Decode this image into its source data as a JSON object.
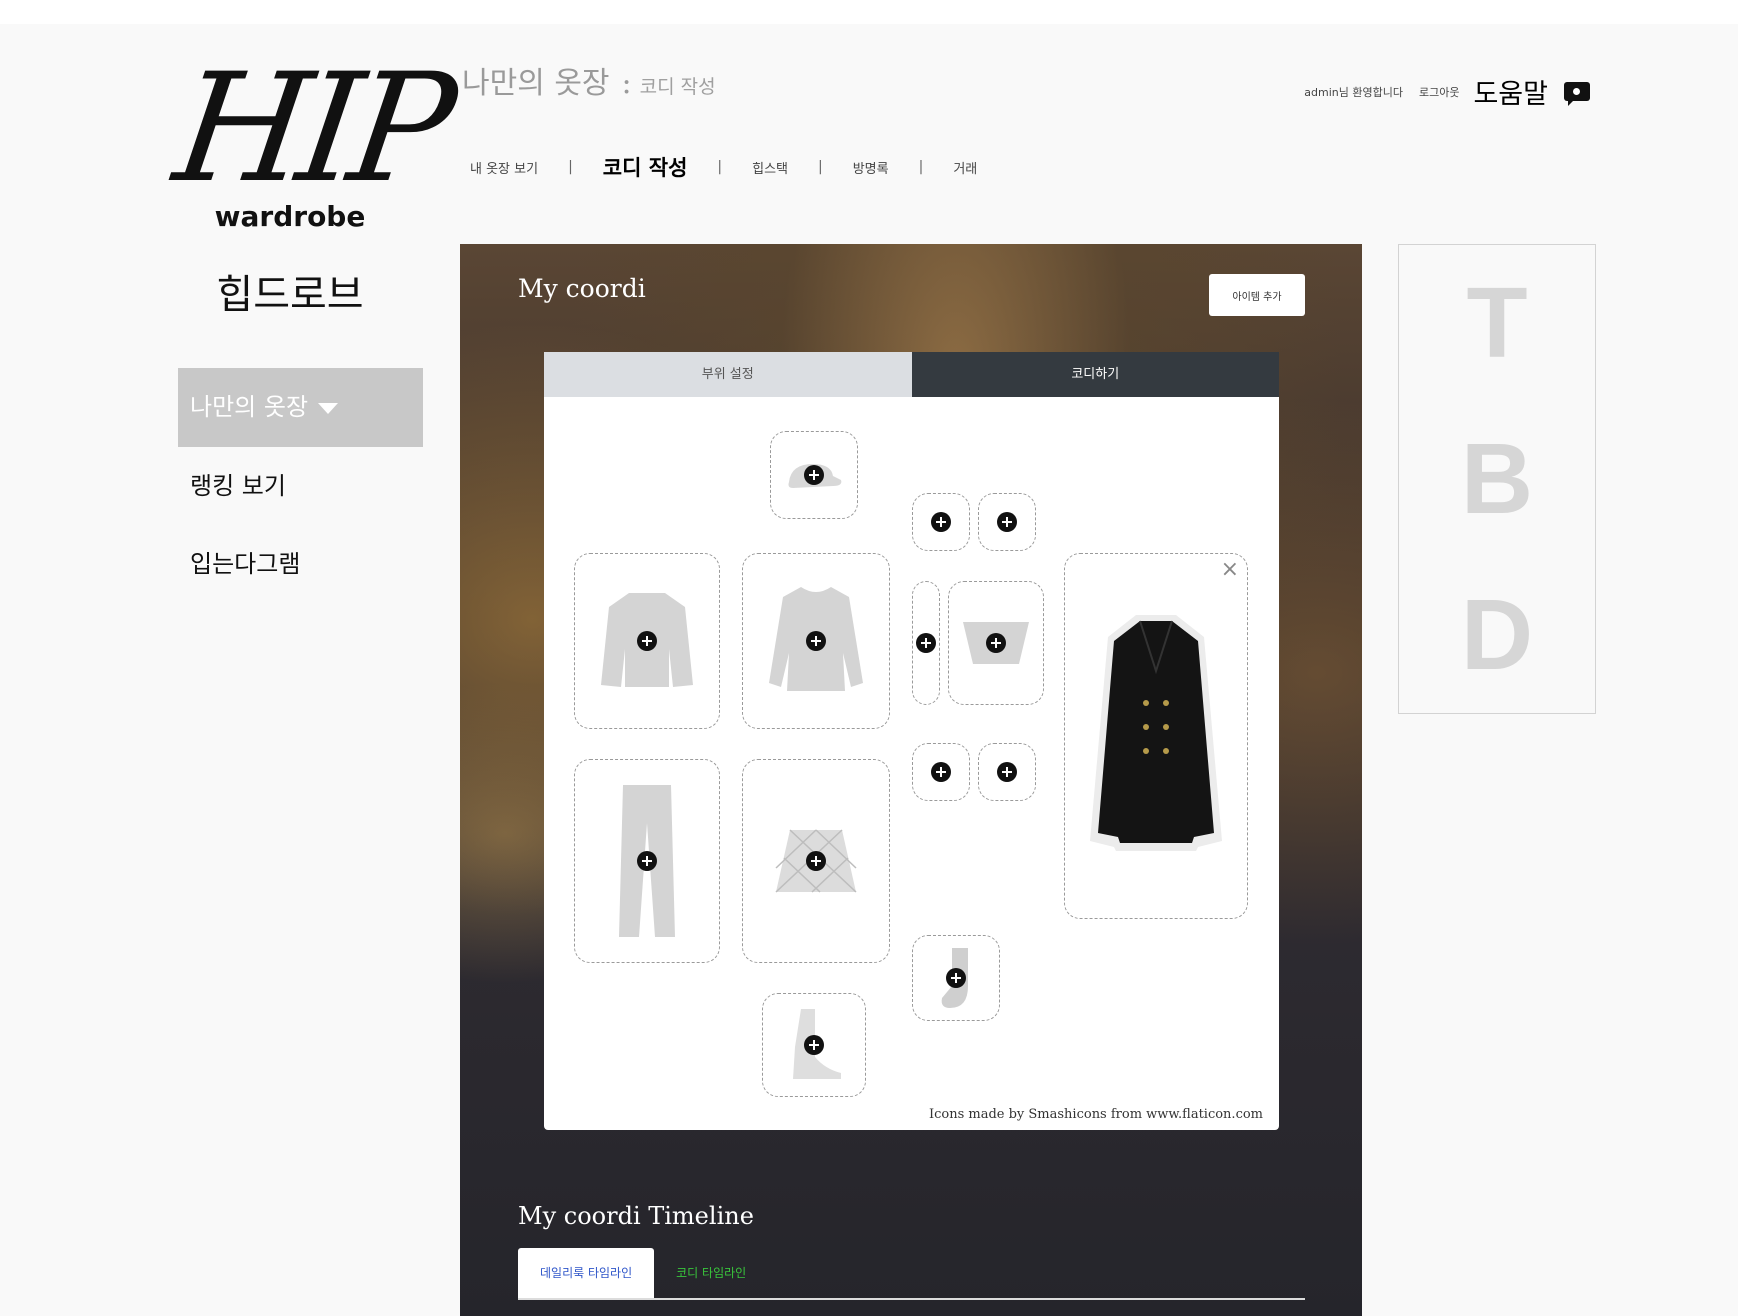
{
  "logo": {
    "mark": "HIP",
    "subtitle": "wardrobe",
    "korean": "힙드로브"
  },
  "sidebar": {
    "items": [
      {
        "label": "나만의 옷장"
      },
      {
        "label": "랭킹 보기"
      },
      {
        "label": "입는다그램"
      }
    ]
  },
  "header": {
    "title": "나만의 옷장",
    "separator": ":",
    "subtitle": "코디 작성",
    "nav": [
      {
        "label": "내 옷장 보기"
      },
      {
        "label": "코디 작성"
      },
      {
        "label": "힙스택"
      },
      {
        "label": "방명록"
      },
      {
        "label": "거래"
      }
    ],
    "nav_separator": "|",
    "greeting": "admin님 환영합니다",
    "logout": "로그아웃",
    "help": "도움말"
  },
  "main": {
    "title": "My coordi",
    "add_item_button": "아이템 추가",
    "tabs": [
      {
        "label": "부위 설정"
      },
      {
        "label": "코디하기"
      }
    ],
    "close_symbol": "×",
    "credit": "Icons made by Smashicons from www.flaticon.com",
    "timeline_title": "My coordi Timeline",
    "timeline_tabs": [
      {
        "label": "데일리룩 타임라인"
      },
      {
        "label": "코디 타임라인"
      }
    ]
  },
  "tbd": {
    "letters": [
      "T",
      "B",
      "D"
    ]
  },
  "colors": {
    "active_sidebar": "#c8c8c8",
    "tab_dark": "#343a40",
    "tab_light": "#dbdee2",
    "timeline_daily": "#2f56c9",
    "timeline_coordi": "#39c53c"
  },
  "icons": [
    "plus-circle-icon",
    "close-icon",
    "chat-icon",
    "caret-down-icon"
  ]
}
